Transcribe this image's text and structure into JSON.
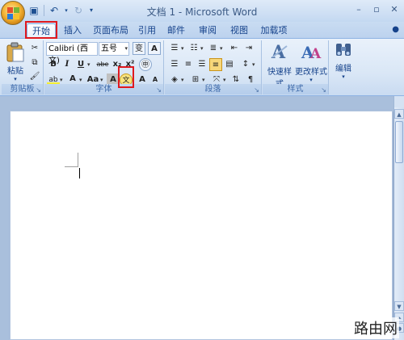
{
  "window": {
    "title": "文档 1 - Microsoft Word",
    "controls": [
      "minimize",
      "restore",
      "close"
    ]
  },
  "quick_access": [
    "save-icon",
    "undo-icon",
    "redo-icon"
  ],
  "tabs": [
    {
      "label": "开始",
      "active": true
    },
    {
      "label": "插入"
    },
    {
      "label": "页面布局"
    },
    {
      "label": "引用"
    },
    {
      "label": "邮件"
    },
    {
      "label": "审阅"
    },
    {
      "label": "视图"
    },
    {
      "label": "加载项"
    }
  ],
  "ribbon": {
    "clipboard": {
      "paste_label": "粘贴",
      "group_label": "剪贴板"
    },
    "font": {
      "font_name": "Calibri (西文)",
      "font_size": "五号",
      "group_label": "字体",
      "grow_label": "A",
      "shrink_label": "A",
      "case_label": "Aa",
      "highlight_label": "ab",
      "font_color_label": "A",
      "char_shade_label": "A",
      "strike_label": "abe",
      "sub_label": "x₂",
      "sup_label": "x²",
      "bold_label": "B",
      "italic_label": "I",
      "underline_label": "U",
      "phonetic_label": "文",
      "border_label": "A",
      "clear_label": "变"
    },
    "paragraph": {
      "group_label": "段落"
    },
    "styles": {
      "quick_styles_label": "快速样式",
      "change_styles_label": "更改样式",
      "group_label": "样式"
    },
    "editing": {
      "label": "编辑"
    }
  },
  "watermark": "路由网",
  "colors": {
    "accent_red": "#e0191f",
    "ribbon_blue": "#15428b"
  }
}
